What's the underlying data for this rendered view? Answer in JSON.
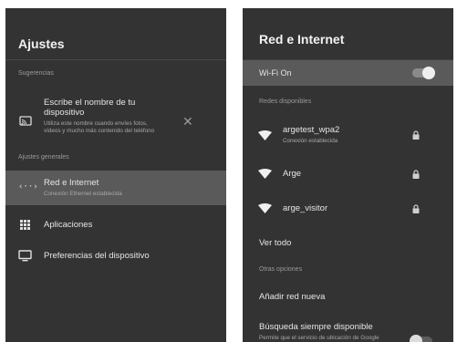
{
  "left": {
    "title": "Ajustes",
    "suggestions_section": "Sugerencias",
    "suggestion": {
      "title_line1": "Escribe el nombre de tu",
      "title_line2": "dispositivo",
      "desc_line1": "Utiliza este nombre cuando envíes fotos,",
      "desc_line2": "vídeos y mucho más contenido del teléfono",
      "icon": "cast-icon",
      "dismiss_icon": "close-icon"
    },
    "general_section": "Ajustes generales",
    "items": [
      {
        "label": "Red e Internet",
        "sub": "Conexión Ethernet establecida",
        "icon": "ethernet-icon",
        "selected": true
      },
      {
        "label": "Aplicaciones",
        "icon": "apps-grid-icon"
      },
      {
        "label": "Preferencias del dispositivo",
        "icon": "tv-icon"
      }
    ]
  },
  "right": {
    "title": "Red e Internet",
    "wifi_toggle": {
      "label": "Wi-Fi On",
      "on": true
    },
    "available_section": "Redes disponibles",
    "networks": [
      {
        "name": "argetest_wpa2",
        "status": "Conexión establecida",
        "secured": true,
        "icon": "wifi-icon"
      },
      {
        "name": "Arge",
        "status": "",
        "secured": true,
        "icon": "wifi-icon"
      },
      {
        "name": "arge_visitor",
        "status": "",
        "secured": true,
        "icon": "wifi-icon"
      }
    ],
    "see_all": "Ver todo",
    "other_section": "Otras opciones",
    "add_network": "Añadir red nueva",
    "always_scan": {
      "label": "Búsqueda siempre disponible",
      "sub": "Permite que el servicio de ubicación de Google",
      "on": false
    }
  },
  "colors": {
    "panel": "#333333",
    "highlight": "#5a5a5a",
    "text": "#e6e6e6",
    "muted": "#9a9a9a"
  }
}
